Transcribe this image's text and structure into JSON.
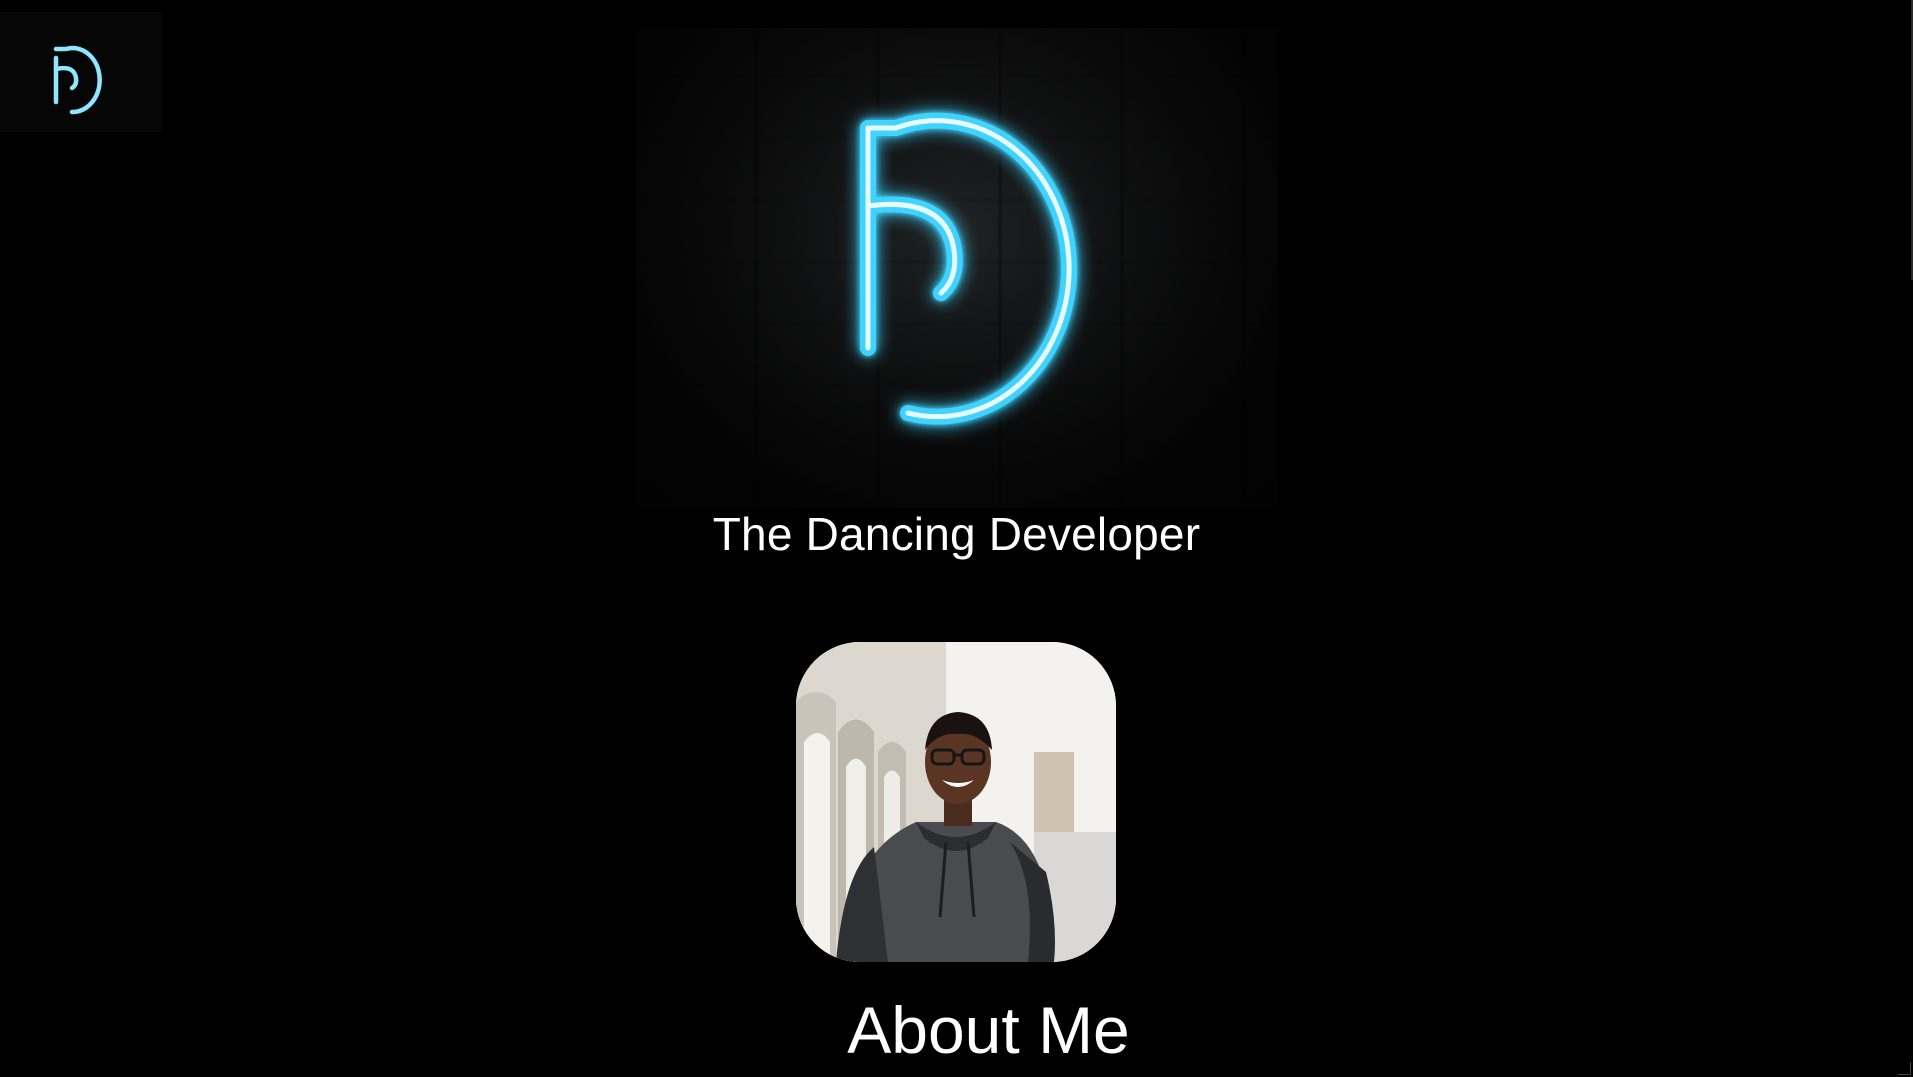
{
  "header": {
    "logo_icon": "dd-monogram-icon"
  },
  "hero": {
    "logo_icon": "neon-dd-monogram-icon",
    "title": "The Dancing Developer"
  },
  "profile": {
    "photo_icon": "profile-photo"
  },
  "about": {
    "heading": "About Me"
  },
  "colors": {
    "background": "#000000",
    "neon": "#3fd3ff",
    "text": "#ffffff"
  }
}
